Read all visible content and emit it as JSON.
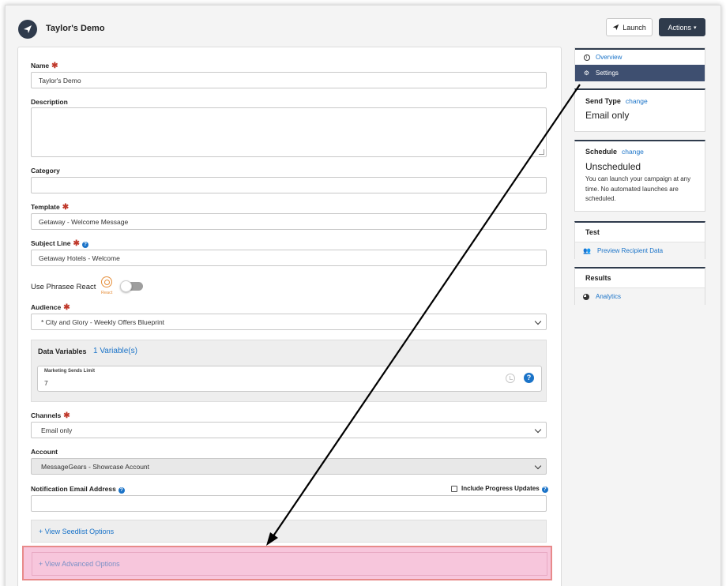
{
  "header": {
    "title": "Taylor's Demo",
    "launch_label": "Launch",
    "actions_label": "Actions"
  },
  "form": {
    "name": {
      "label": "Name",
      "value": "Taylor's Demo"
    },
    "description": {
      "label": "Description",
      "value": ""
    },
    "category": {
      "label": "Category",
      "value": ""
    },
    "template": {
      "label": "Template",
      "value": "Getaway - Welcome Message"
    },
    "subject_line": {
      "label": "Subject Line",
      "value": "Getaway Hotels - Welcome"
    },
    "phrasee": {
      "label": "Use Phrasee React",
      "badge": "React",
      "enabled": false
    },
    "audience": {
      "label": "Audience",
      "value": "* City and Glory - Weekly Offers Blueprint"
    },
    "data_variables": {
      "title": "Data Variables",
      "count": "1 Variable(s)",
      "field_label": "Marketing Sends Limit",
      "field_value": "7"
    },
    "channels": {
      "label": "Channels",
      "value": "Email only"
    },
    "account": {
      "label": "Account",
      "value": "MessageGears - Showcase Account"
    },
    "notification": {
      "label": "Notification Email Address",
      "value": ""
    },
    "progress_updates": {
      "label": "Include Progress Updates",
      "checked": false
    },
    "seedlist_label": "+ View Seedlist Options",
    "advanced_label": "+ View Advanced Options"
  },
  "sidebar": {
    "nav": [
      {
        "label": "Overview",
        "icon": "info-circle-icon"
      },
      {
        "label": "Settings",
        "icon": "gear-icon"
      }
    ],
    "send_type": {
      "title": "Send Type",
      "link": "change",
      "value": "Email only"
    },
    "schedule": {
      "title": "Schedule",
      "link": "change",
      "value": "Unscheduled",
      "note": "You can launch your campaign at any time. No automated launches are scheduled."
    },
    "test": {
      "title": "Test",
      "item": "Preview Recipient Data"
    },
    "results": {
      "title": "Results",
      "item": "Analytics"
    }
  },
  "colors": {
    "brand_dark": "#2f3b4c",
    "nav_active": "#3e4f70",
    "link": "#1a73c8",
    "required": "#c0392b",
    "highlight": "#f7c6dc"
  }
}
